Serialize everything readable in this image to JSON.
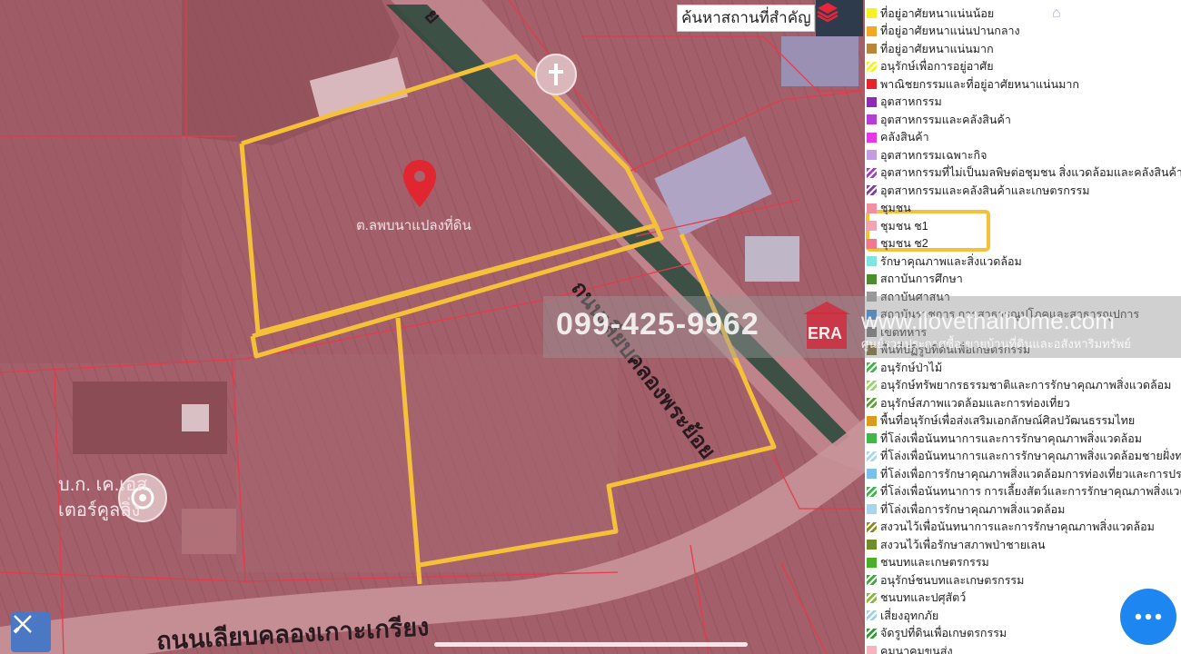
{
  "search": {
    "placeholder": "ค้นหาสถานที่สำคัญ"
  },
  "map": {
    "parcel_label": "ต.ลพบนาแปลงที่ดิน",
    "road_label_diagonal": "ถนนเลียบคลองพระย้อย",
    "road_label_top": "ย",
    "road_label_bottom": "ถนนเลียบคลองเกาะเกรียง",
    "company_label_line1": "บ.ก. เค.เอส.",
    "company_label_line2": "เตอร์คูลลิ่ง",
    "overlay_color": "#a8636c",
    "boundary_color": "#f5c13a",
    "parcel_line_color": "#e53a4a",
    "pin_color": "#e0262f"
  },
  "watermark": {
    "phone": "099-425-9962",
    "logo_text": "ERA",
    "site": "www.ilovethaihome.com",
    "subtitle": "ศูนย์รวมประกาศซื้อ-ขายบ้านที่ดินและอสังหาริมทรัพย์"
  },
  "legend": {
    "highlight_color": "#f5c13a",
    "items": [
      {
        "label": "ที่อยู่อาศัยหนาแน่นน้อย",
        "color": "#f7f022",
        "pattern": "solid"
      },
      {
        "label": "ที่อยู่อาศัยหนาแน่นปานกลาง",
        "color": "#f5a623",
        "pattern": "solid"
      },
      {
        "label": "ที่อยู่อาศัยหนาแน่นมาก",
        "color": "#b8863b",
        "pattern": "solid"
      },
      {
        "label": "อนุรักษ์เพื่อการอยู่อาศัย",
        "color": "#f7f022",
        "pattern": "hatch"
      },
      {
        "label": "พาณิชยกรรมและที่อยู่อาศัยหนาแน่นมาก",
        "color": "#e8232a",
        "pattern": "solid"
      },
      {
        "label": "อุตสาหกรรม",
        "color": "#8e2bb5",
        "pattern": "solid"
      },
      {
        "label": "อุตสาหกรรมและคลังสินค้า",
        "color": "#b23ed6",
        "pattern": "solid"
      },
      {
        "label": "คลังสินค้า",
        "color": "#e338e3",
        "pattern": "solid"
      },
      {
        "label": "อุตสาหกรรมเฉพาะกิจ",
        "color": "#c59be3",
        "pattern": "solid"
      },
      {
        "label": "อุตสาหกรรมที่ไม่เป็นมลพิษต่อชุมชน สิ่งแวดล้อมและคลังสินค้า",
        "color": "#a13fc4",
        "pattern": "hatch"
      },
      {
        "label": "อุตสาหกรรมและคลังสินค้าและเกษตรกรรม",
        "color": "#7e3d99",
        "pattern": "hatch"
      },
      {
        "label": "ชุมชน",
        "color": "#f08fa0",
        "pattern": "solid"
      },
      {
        "label": "ชุมชน ช1",
        "color": "#f4a3b3",
        "pattern": "solid"
      },
      {
        "label": "ชุมชน ช2",
        "color": "#f07a8d",
        "pattern": "solid"
      },
      {
        "label": "รักษาคุณภาพและสิ่งแวดล้อม",
        "color": "#7fe3e0",
        "pattern": "solid"
      },
      {
        "label": "สถาบันการศึกษา",
        "color": "#4d8c2e",
        "pattern": "solid"
      },
      {
        "label": "สถาบันศาสนา",
        "color": "#9a9a9a",
        "pattern": "solid"
      },
      {
        "label": "สถาบันราชการ การสาธารณูปโภคและสาธารณูปการ",
        "color": "#2a7fd4",
        "pattern": "solid"
      },
      {
        "label": "เขตทหาร",
        "color": "#6b6b6b",
        "pattern": "solid"
      },
      {
        "label": "พื้นที่ปฏิรูปที่ดินเพื่อเกษตรกรรม",
        "color": "#6b5a1e",
        "pattern": "solid"
      },
      {
        "label": "อนุรักษ์ป่าไม้",
        "color": "#3bb54a",
        "pattern": "hatch"
      },
      {
        "label": "อนุรักษ์ทรัพยากรธรรมชาติและการรักษาคุณภาพสิ่งแวดล้อม",
        "color": "#9ad66a",
        "pattern": "hatch"
      },
      {
        "label": "อนุรักษ์สภาพแวดล้อมและการท่องเที่ยว",
        "color": "#5a9e3a",
        "pattern": "hatch"
      },
      {
        "label": "พื้นที่อนุรักษ์เพื่อส่งเสริมเอกลักษณ์ศิลปวัฒนธรรมไทย",
        "color": "#d99a1e",
        "pattern": "solid"
      },
      {
        "label": "ที่โล่งเพื่อนันทนาการและการรักษาคุณภาพสิ่งแวดล้อม",
        "color": "#3fb84a",
        "pattern": "solid"
      },
      {
        "label": "ที่โล่งเพื่อนันทนาการและการรักษาคุณภาพสิ่งแวดล้อมชายฝั่งทะเล",
        "color": "#a7d8f0",
        "pattern": "hatch"
      },
      {
        "label": "ที่โล่งเพื่อการรักษาคุณภาพสิ่งแวดล้อมการท่องเที่ยวและการประม",
        "color": "#7cc0e8",
        "pattern": "solid"
      },
      {
        "label": "ที่โล่งเพื่อนันทนาการ การเลี้ยงสัตว์และการรักษาคุณภาพสิ่งแวดล้อ",
        "color": "#3bb54a",
        "pattern": "hatch"
      },
      {
        "label": "ที่โล่งเพื่อการรักษาคุณภาพสิ่งแวดล้อม",
        "color": "#a8d4ef",
        "pattern": "solid"
      },
      {
        "label": "สงวนไว้เพื่อนันทนาการและการรักษาคุณภาพสิ่งแวดล้อม",
        "color": "#8a8a1e",
        "pattern": "hatch"
      },
      {
        "label": "สงวนไว้เพื่อรักษาสภาพป่าชายเลน",
        "color": "#6d8c2a",
        "pattern": "solid"
      },
      {
        "label": "ชนบทและเกษตรกรรม",
        "color": "#4caf2a",
        "pattern": "solid"
      },
      {
        "label": "อนุรักษ์ชนบทและเกษตรกรรม",
        "color": "#3fa83a",
        "pattern": "hatch"
      },
      {
        "label": "ชนบทและปศุสัตว์",
        "color": "#86b83a",
        "pattern": "hatch"
      },
      {
        "label": "เสี่ยงอุทกภัย",
        "color": "#9fd0e8",
        "pattern": "hatch"
      },
      {
        "label": "จัดรูปที่ดินเพื่อเกษตรกรรม",
        "color": "#2f9a2f",
        "pattern": "hatch"
      },
      {
        "label": "คมนาคมขนส่ง",
        "color": "#f4b3bd",
        "pattern": "solid"
      }
    ]
  }
}
